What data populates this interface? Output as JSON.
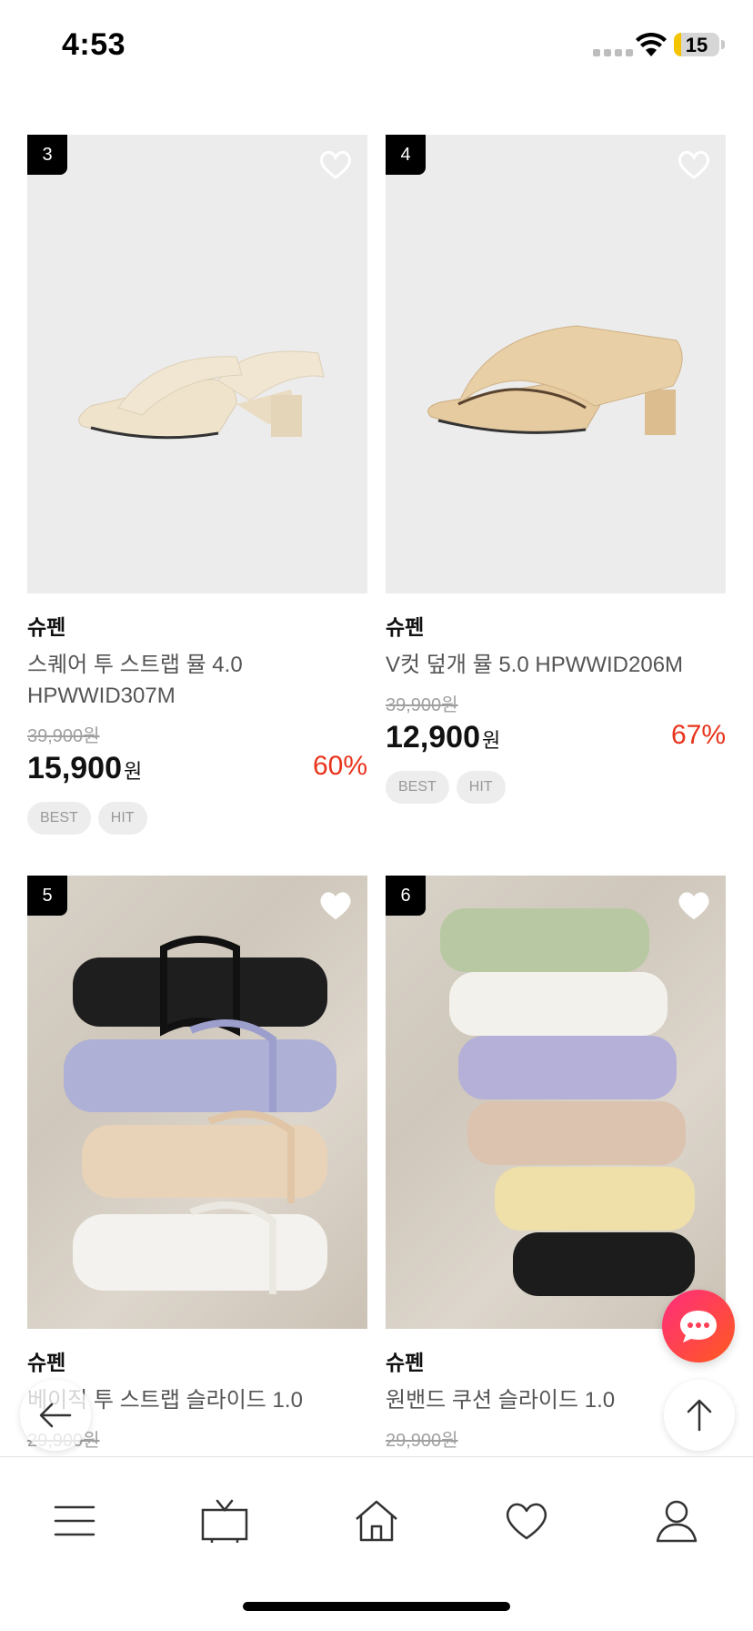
{
  "status_bar": {
    "time": "4:53",
    "battery_level": "15",
    "battery_color": "#f5c400"
  },
  "products": [
    {
      "rank": "3",
      "brand": "슈펜",
      "name": "스퀘어 투 스트랩 뮬 4.0 HPWWID307M",
      "original_price": "39,900원",
      "price": "15,900",
      "currency": "원",
      "discount": "60%",
      "badges": [
        "BEST",
        "HIT"
      ],
      "wishlist_icon": "heart-outline-icon"
    },
    {
      "rank": "4",
      "brand": "슈펜",
      "name": "V컷 덮개 뮬 5.0 HPWWID206M",
      "original_price": "39,900원",
      "price": "12,900",
      "currency": "원",
      "discount": "67%",
      "badges": [
        "BEST",
        "HIT"
      ],
      "wishlist_icon": "heart-outline-icon"
    },
    {
      "rank": "5",
      "brand": "슈펜",
      "name": "베이직 투 스트랩 슬라이드 1.0",
      "original_price": "29,900원",
      "wishlist_icon": "heart-filled-icon"
    },
    {
      "rank": "6",
      "brand": "슈펜",
      "name": "원밴드 쿠션 슬라이드 1.0",
      "original_price": "29,900원",
      "wishlist_icon": "heart-filled-icon"
    }
  ],
  "accent_colors": {
    "discount": "#e8341c",
    "chat_gradient_start": "#ff2d7e",
    "chat_gradient_end": "#ff5a1f"
  },
  "floating": {
    "chat_icon": "chat-bubble-icon",
    "back_icon": "arrow-left-icon",
    "top_icon": "arrow-up-icon"
  },
  "bottom_nav": [
    {
      "icon": "menu-icon"
    },
    {
      "icon": "tv-icon"
    },
    {
      "icon": "home-icon"
    },
    {
      "icon": "heart-icon"
    },
    {
      "icon": "user-icon"
    }
  ]
}
